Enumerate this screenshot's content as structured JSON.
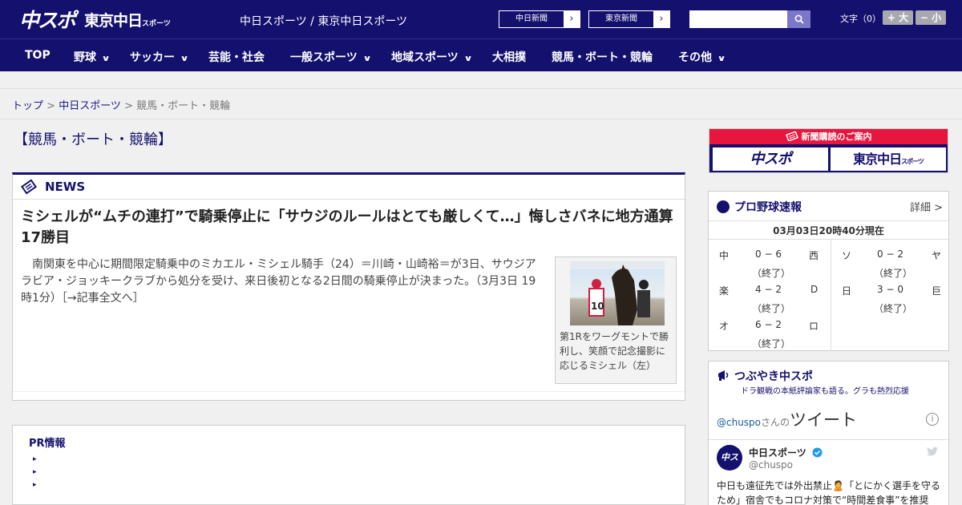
{
  "header": {
    "logo_main": "中スポ",
    "logo_sub": "東京中日",
    "logo_sub_small": "スポーツ",
    "site_name": "中日スポーツ / 東京中日スポーツ",
    "link_chunichi": "中日新聞",
    "link_tokyo": "東京新聞",
    "search_placeholder": "",
    "font_size_label": "文字（0）",
    "font_up": "+ 大",
    "font_down": "− 小"
  },
  "nav": {
    "items": [
      {
        "label": "TOP"
      },
      {
        "label": "野球"
      },
      {
        "label": "サッカー"
      },
      {
        "label": "芸能・社会"
      },
      {
        "label": "一般スポーツ"
      },
      {
        "label": "地域スポーツ"
      },
      {
        "label": "大相撲"
      },
      {
        "label": "競馬・ボート・競輪"
      },
      {
        "label": "その他"
      }
    ]
  },
  "breadcrumb": {
    "top": "トップ",
    "sep": " > ",
    "section": "中日スポーツ",
    "current": "競馬・ボート・競輪"
  },
  "page_title": "【競馬・ボート・競輪】",
  "news": {
    "label": "NEWS",
    "headline": "ミシェルが“ムチの連打”で騎乗停止に「サウジのルールはとても厳しくて…」悔しさバネに地方通算17勝目",
    "lead": "南関東を中心に期間限定騎乗中のミカエル・ミシェル騎手（24）＝川崎・山崎裕＝が3日、サウジアラビア・ジョッキークラブから処分を受け、来日後初となる2日間の騎乗停止が決まった。（3月3日 19時1分）［→記事全文へ］",
    "photo_caption": "第1Rをワーグモントで勝利し、笑顔で記念撮影に応じるミシェル（左）"
  },
  "pr": {
    "title": "PR情報",
    "bullet": "▸"
  },
  "subscribe": {
    "bar": "新聞購読のご案内",
    "btn1": "中スポ",
    "btn2": "東京中日",
    "btn2_small": "スポーツ"
  },
  "baseball": {
    "title": "プロ野球速報",
    "more": "詳細 >",
    "time": "03月03日20時40分現在",
    "games": [
      {
        "home": "中",
        "score": "0 − 6",
        "status": "（終了）",
        "away": "西"
      },
      {
        "home": "ソ",
        "score": "0 − 2",
        "status": "（終了）",
        "away": "ヤ"
      },
      {
        "home": "楽",
        "score": "4 − 2",
        "status": "（終了）",
        "away": "D"
      },
      {
        "home": "日",
        "score": "3 − 0",
        "status": "（終了）",
        "away": "巨"
      },
      {
        "home": "オ",
        "score": "6 − 2",
        "status": "（終了）",
        "away": "ロ"
      }
    ]
  },
  "tweets": {
    "title": "つぶやき中スポ",
    "subtitle": "ドラ観戦の本紙評論家も語る。グラも熱烈応援",
    "handle_link": "@chuspo",
    "handle_suffix": "さんの",
    "tweets_word": "ツイート",
    "info": "i",
    "user_name": "中日スポーツ",
    "user_handle": "@chuspo",
    "avatar": "中スポ",
    "body": "中日も遠征先では外出禁止🙎「とにかく選手を守るため」宿舎でもコロナ対策で“時間差食事”を推奨"
  },
  "colors": {
    "brand": "#14106e",
    "accent_red": "#e8163e",
    "search_btn": "#7b77c9"
  }
}
